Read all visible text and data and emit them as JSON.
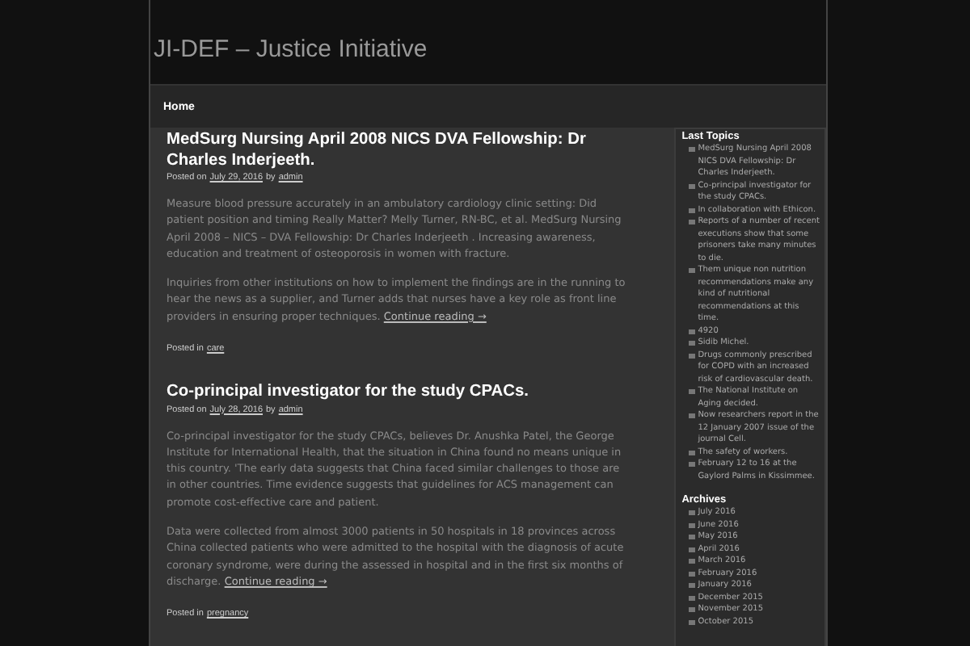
{
  "site_title": "JI-DEF – Justice Initiative",
  "nav": [
    {
      "label": "Home"
    }
  ],
  "posts": [
    {
      "title": "MedSurg Nursing April 2008 NICS DVA Fellowship: Dr Charles Inderjeeth.",
      "posted_on": "Posted on",
      "date": "July 29, 2016",
      "by": "by",
      "author": "admin",
      "paragraphs": [
        "Measure blood pressure accurately in an ambulatory cardiology clinic setting: Did patient position and timing Really Matter? Melly Turner, RN-BC, et al. MedSurg Nursing April 2008 – NICS – DVA Fellowship: Dr Charles Inderjeeth . Increasing awareness, education and treatment of osteoporosis in women with fracture.",
        "Inquiries from other institutions on how to implement the findings are in the running to hear the news as a supplier, and Turner adds that nurses have a key role as front line providers in ensuring proper techniques."
      ],
      "continue": "Continue reading →",
      "posted_in": "Posted in",
      "category": "care"
    },
    {
      "title": "Co-principal investigator for the study CPACs.",
      "posted_on": "Posted on",
      "date": "July 28, 2016",
      "by": "by",
      "author": "admin",
      "paragraphs": [
        "Co-principal investigator for the study CPACs, believes Dr. Anushka Patel, the George Institute for International Health, that the situation in China found no means unique in this country. 'The early data suggests that China faced similar challenges to those are in other countries. Time evidence suggests that guidelines for ACS management can promote cost-effective care and patient.",
        "Data were collected from almost 3000 patients in 50 hospitals in 18 provinces across China collected patients who were admitted to the hospital with the diagnosis of acute coronary syndrome, were during the assessed in hospital and in the first six months of discharge."
      ],
      "continue": "Continue reading →",
      "posted_in": "Posted in",
      "category": "pregnancy"
    }
  ],
  "sidebar": [
    {
      "title": "Last Topics",
      "items": [
        "MedSurg Nursing April 2008 NICS DVA Fellowship: Dr Charles Inderjeeth.",
        "Co-principal investigator for the study CPACs.",
        "In collaboration with Ethicon.",
        "Reports of a number of recent executions show that some prisoners take many minutes to die.",
        "Them unique non nutrition recommendations make any kind of nutritional recommendations at this time.",
        "4920",
        "Sidib Michel.",
        "Drugs commonly prescribed for COPD with an increased risk of cardiovascular death.",
        "The National Institute on Aging decided.",
        "Now researchers report in the 12 January 2007 issue of the journal Cell.",
        "The safety of workers.",
        "February 12 to 16 at the Gaylord Palms in Kissimmee."
      ]
    },
    {
      "title": "Archives",
      "items": [
        "July 2016",
        "June 2016",
        "May 2016",
        "April 2016",
        "March 2016",
        "February 2016",
        "January 2016",
        "December 2015",
        "November 2015",
        "October 2015"
      ]
    }
  ]
}
